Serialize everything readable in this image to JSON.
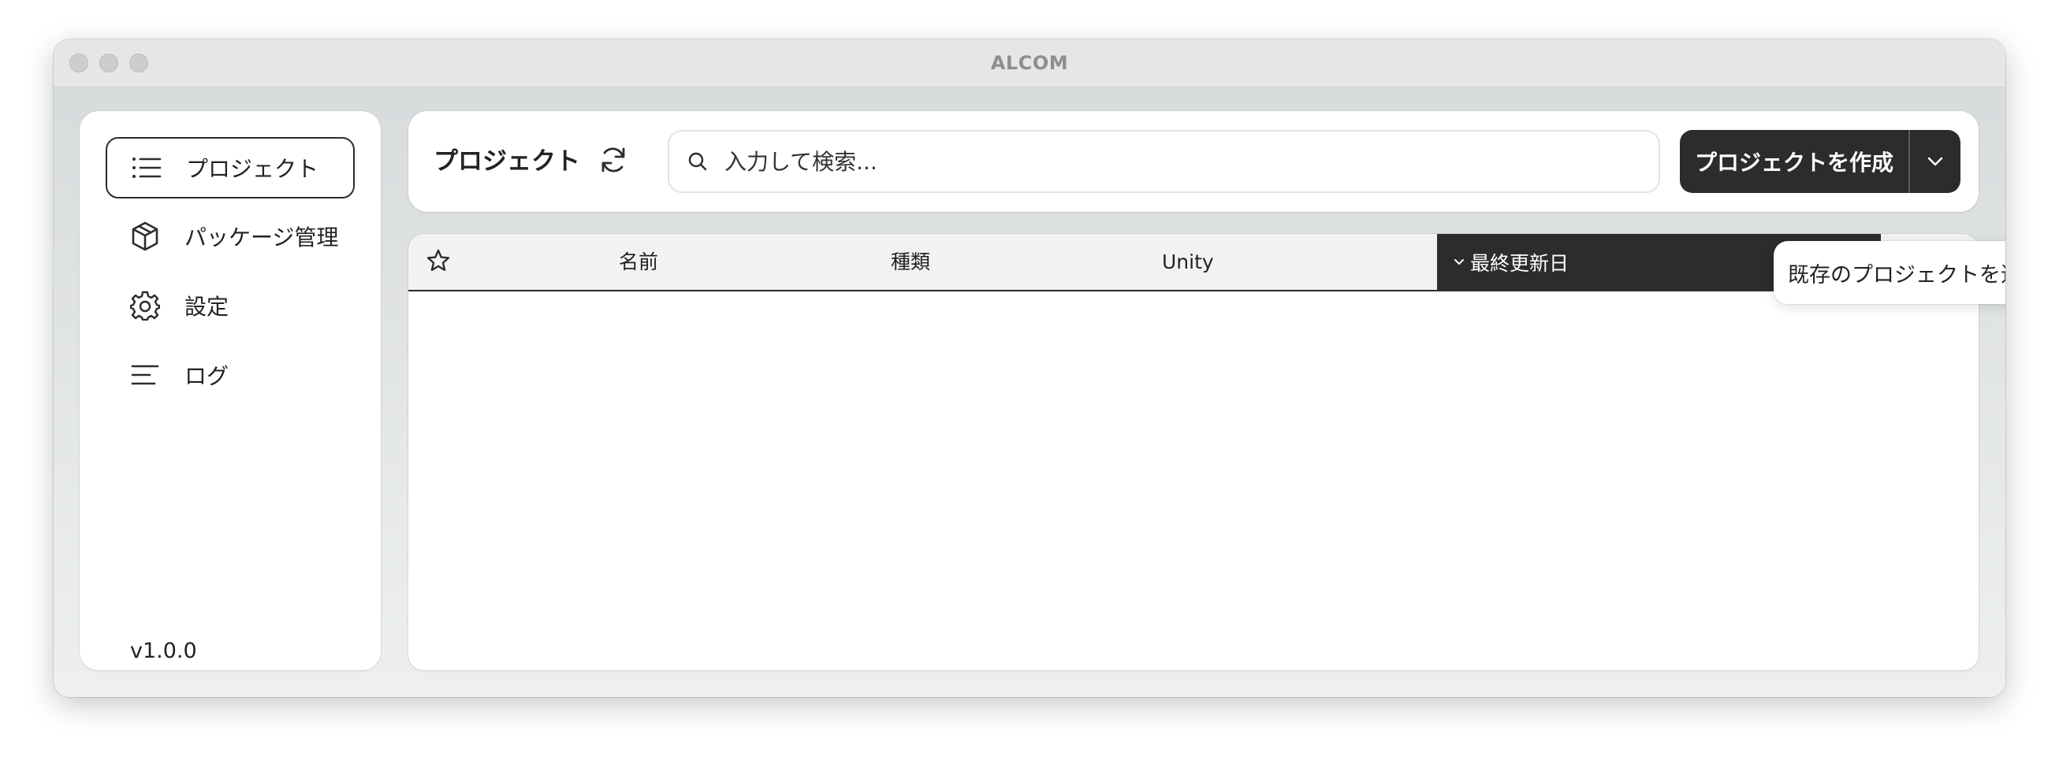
{
  "window": {
    "title": "ALCOM"
  },
  "sidebar": {
    "items": [
      {
        "label": "プロジェクト",
        "icon": "list-icon",
        "active": true
      },
      {
        "label": "パッケージ管理",
        "icon": "package-icon",
        "active": false
      },
      {
        "label": "設定",
        "icon": "gear-icon",
        "active": false
      },
      {
        "label": "ログ",
        "icon": "log-lines-icon",
        "active": false
      }
    ],
    "version": "v1.0.0"
  },
  "header": {
    "title": "プロジェクト",
    "refresh_icon": "refresh-icon",
    "search": {
      "placeholder": "入力して検索...",
      "value": ""
    },
    "create_button": "プロジェクトを作成",
    "dropdown_icon": "chevron-down-icon"
  },
  "table": {
    "columns": [
      {
        "label": "",
        "icon": "star-outline-icon"
      },
      {
        "label": "名前"
      },
      {
        "label": "種類"
      },
      {
        "label": "Unity"
      },
      {
        "label": "最終更新日",
        "sorted": "desc"
      }
    ],
    "rows": []
  },
  "popover": {
    "items": [
      "既存のプロジェクトを追加"
    ]
  },
  "colors": {
    "accent_dark": "#2c2c2e",
    "card_bg": "#ffffff",
    "header_bg": "#f2f2f2",
    "window_bg": "#dcdfe0"
  }
}
